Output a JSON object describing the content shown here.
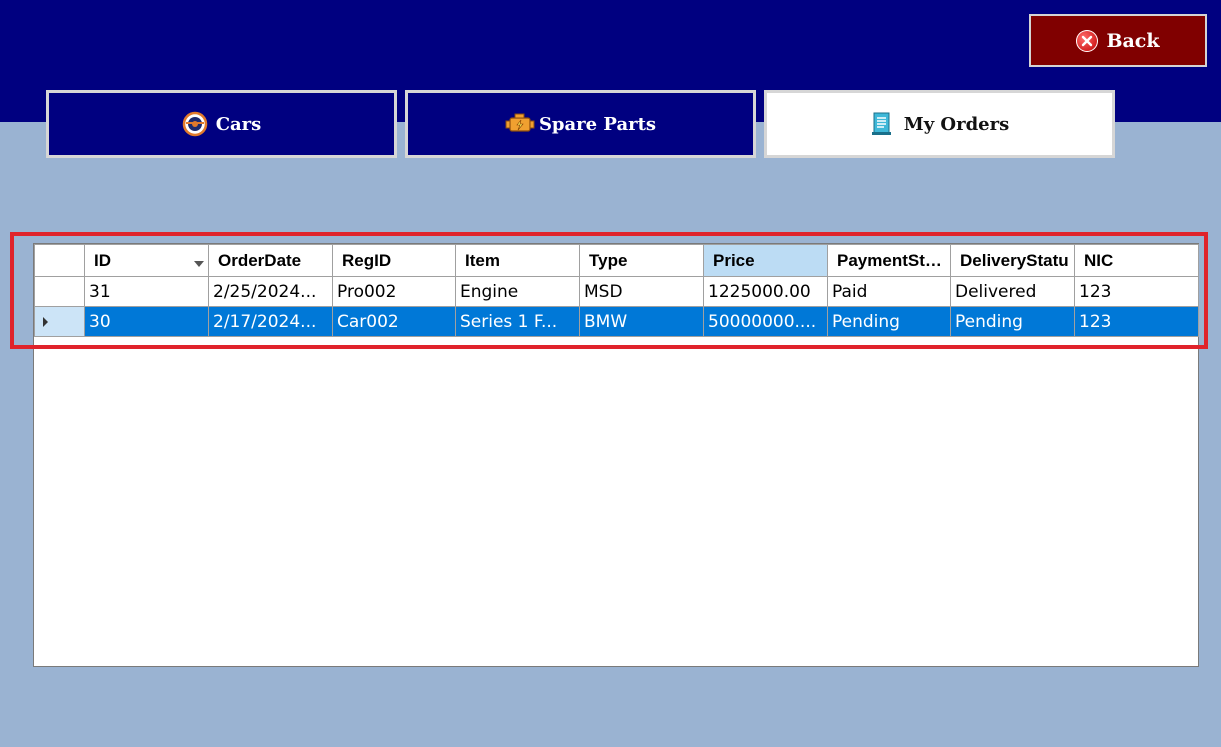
{
  "header": {
    "back_label": "Back"
  },
  "tabs": [
    {
      "label": "Cars",
      "icon": "steering-wheel-icon"
    },
    {
      "label": "Spare Parts",
      "icon": "engine-icon"
    },
    {
      "label": "My Orders",
      "icon": "receipt-icon",
      "active": true
    }
  ],
  "grid": {
    "columns": [
      "ID",
      "OrderDate",
      "RegID",
      "Item",
      "Type",
      "Price",
      "PaymentStatu",
      "DeliveryStatu",
      "NIC"
    ],
    "rows": [
      {
        "id": "31",
        "order_date": "2/25/2024...",
        "reg_id": "Pro002",
        "item": "Engine",
        "type": "MSD",
        "price": "1225000.00",
        "payment": "Paid",
        "delivery": "Delivered",
        "nic": "123"
      },
      {
        "id": "30",
        "order_date": "2/17/2024...",
        "reg_id": "Car002",
        "item": "Series 1 F...",
        "type": "BMW",
        "price": "50000000....",
        "payment": "Pending",
        "delivery": "Pending",
        "nic": "123"
      }
    ]
  },
  "colors": {
    "header_band": "#000080",
    "background": "#9ab3d2",
    "back_button": "#800000",
    "selection": "#0078d7",
    "highlight": "#e0232b"
  }
}
